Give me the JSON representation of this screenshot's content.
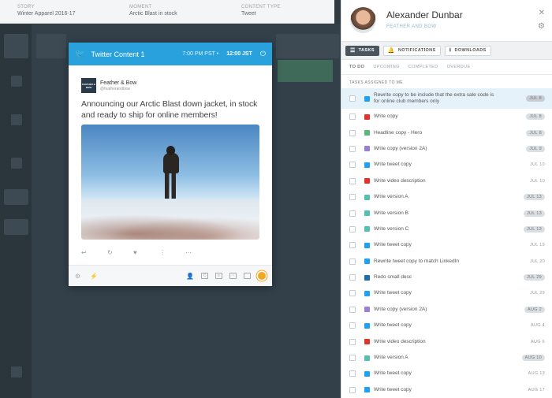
{
  "background": {
    "columns": [
      {
        "label": "STORY",
        "value": "Winter Apparel 2016-17"
      },
      {
        "label": "MOMENT",
        "value": "Arctic Blast in stock"
      },
      {
        "label": "CONTENT TYPE",
        "value": "Tweet"
      }
    ]
  },
  "modal": {
    "title": "Twitter Content 1",
    "time_local": "7:00 PM PST",
    "time_separator": "•",
    "time_jst": "12:00 JST",
    "account_name": "Feather & Bow",
    "account_handle": "@featherandbow",
    "logo_text": "FEATHER & BOW",
    "tweet_text": "Announcing our Arctic Blast down jacket, in stock and ready to ship for online members!",
    "actions": [
      "reply-icon",
      "retweet-icon",
      "like-icon",
      "more-vertical-icon",
      "more-icon"
    ]
  },
  "panel": {
    "user_name": "Alexander Dunbar",
    "org": "FEATHER AND BOW",
    "toolbar": {
      "tasks": "TASKS",
      "notifications": "NOTIFICATIONS",
      "downloads": "DOWNLOADS"
    },
    "subtabs": [
      "TO DO",
      "UPCOMING",
      "COMPLETED",
      "OVERDUE"
    ],
    "section": "TASKS ASSIGNED TO ME",
    "tasks": [
      {
        "icon": "tw",
        "text": "Rewrite copy to be include that the extra sale code is for online club members only",
        "date": "JUL 8",
        "pill": true
      },
      {
        "icon": "yt",
        "text": "Write copy",
        "date": "JUL 8",
        "pill": true
      },
      {
        "icon": "gr",
        "text": "Headline copy - Hero",
        "date": "JUL 8",
        "pill": true
      },
      {
        "icon": "pu",
        "text": "Write copy (version 2A)",
        "date": "JUL 9",
        "pill": true
      },
      {
        "icon": "tw",
        "text": "Write tweet copy",
        "date": "JUL 10",
        "pill": false
      },
      {
        "icon": "yt",
        "text": "Write video description",
        "date": "JUL 10",
        "pill": false
      },
      {
        "icon": "te",
        "text": "Write version A",
        "date": "JUL 13",
        "pill": true
      },
      {
        "icon": "te",
        "text": "Write version B",
        "date": "JUL 13",
        "pill": true
      },
      {
        "icon": "te",
        "text": "Write version C",
        "date": "JUL 13",
        "pill": true
      },
      {
        "icon": "tw",
        "text": "Write tweet copy",
        "date": "JUL 19",
        "pill": false
      },
      {
        "icon": "tw",
        "text": "Rewrite tweet copy to match LinkedIn",
        "date": "JUL 20",
        "pill": false
      },
      {
        "icon": "li",
        "text": "Redo small desc",
        "date": "JUL 29",
        "pill": true
      },
      {
        "icon": "tw",
        "text": "Write tweet copy",
        "date": "JUL 29",
        "pill": false
      },
      {
        "icon": "pu",
        "text": "Write copy (version 2A)",
        "date": "AUG 2",
        "pill": true
      },
      {
        "icon": "tw",
        "text": "Write tweet copy",
        "date": "AUG 4",
        "pill": false
      },
      {
        "icon": "yt",
        "text": "Write video description",
        "date": "AUG 6",
        "pill": false
      },
      {
        "icon": "te",
        "text": "Write version A",
        "date": "AUG 10",
        "pill": true
      },
      {
        "icon": "tw",
        "text": "Write tweet copy",
        "date": "AUG 13",
        "pill": false
      },
      {
        "icon": "tw",
        "text": "Write tweet copy",
        "date": "AUG 17",
        "pill": false
      }
    ]
  }
}
